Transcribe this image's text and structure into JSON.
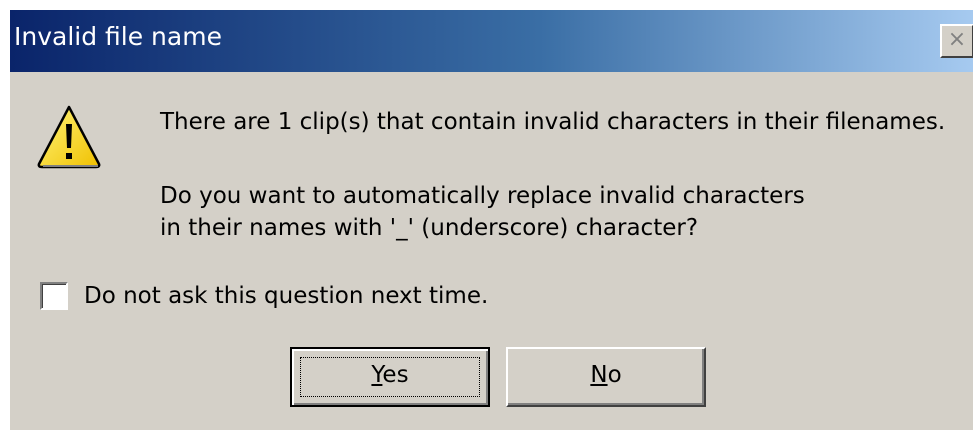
{
  "window": {
    "title": "Invalid file name",
    "close_symbol": "×"
  },
  "icon": {
    "name": "warning-icon",
    "symbol": "!",
    "fill_color": "#ffe000",
    "stroke_color": "#000000"
  },
  "message": {
    "line1": "There are 1 clip(s) that contain invalid characters in their filenames.",
    "line2": "Do you want to automatically replace invalid characters",
    "line3": "in their names with '_' (underscore) character?"
  },
  "checkbox": {
    "label": "Do not ask this question next time.",
    "checked": false
  },
  "buttons": {
    "yes": {
      "mnemonic": "Y",
      "rest": "es",
      "label": "Yes"
    },
    "no": {
      "mnemonic": "N",
      "rest": "o",
      "label": "No"
    }
  },
  "colors": {
    "title_gradient_start": "#0a246a",
    "title_gradient_end": "#a6caf0",
    "dialog_face": "#d4d0c8"
  }
}
